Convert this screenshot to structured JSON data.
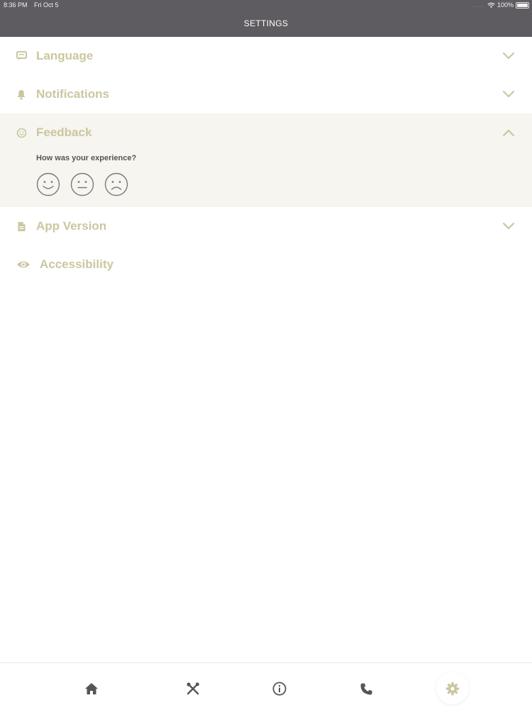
{
  "status_bar": {
    "time": "8:36 PM",
    "date": "Fri Oct 5",
    "signal_dots": "....",
    "battery": "100%"
  },
  "header": {
    "title": "SETTINGS"
  },
  "settings": {
    "items": [
      {
        "label": "Language",
        "icon": "chat-icon",
        "expanded": false
      },
      {
        "label": "Notifications",
        "icon": "bell-icon",
        "expanded": false
      },
      {
        "label": "Feedback",
        "icon": "smiley-icon",
        "expanded": true
      },
      {
        "label": "App Version",
        "icon": "document-icon",
        "expanded": false
      },
      {
        "label": "Accessibility",
        "icon": "eye-icon",
        "expanded": false
      }
    ],
    "feedback": {
      "question": "How was your experience?",
      "faces": [
        "happy-face-icon",
        "neutral-face-icon",
        "sad-face-icon"
      ]
    }
  },
  "tab_bar": {
    "tabs": [
      {
        "name": "home",
        "icon": "home-icon"
      },
      {
        "name": "tools",
        "icon": "tools-icon"
      },
      {
        "name": "info",
        "icon": "info-icon"
      },
      {
        "name": "phone",
        "icon": "phone-icon"
      },
      {
        "name": "settings",
        "icon": "gear-icon",
        "active": true
      }
    ]
  },
  "colors": {
    "header_bg": "#5e5c60",
    "accent": "#cac7a0",
    "feedback_bg": "#f7f5ef",
    "tab_icon": "#555555",
    "active_tab_icon": "#cac7a0"
  }
}
